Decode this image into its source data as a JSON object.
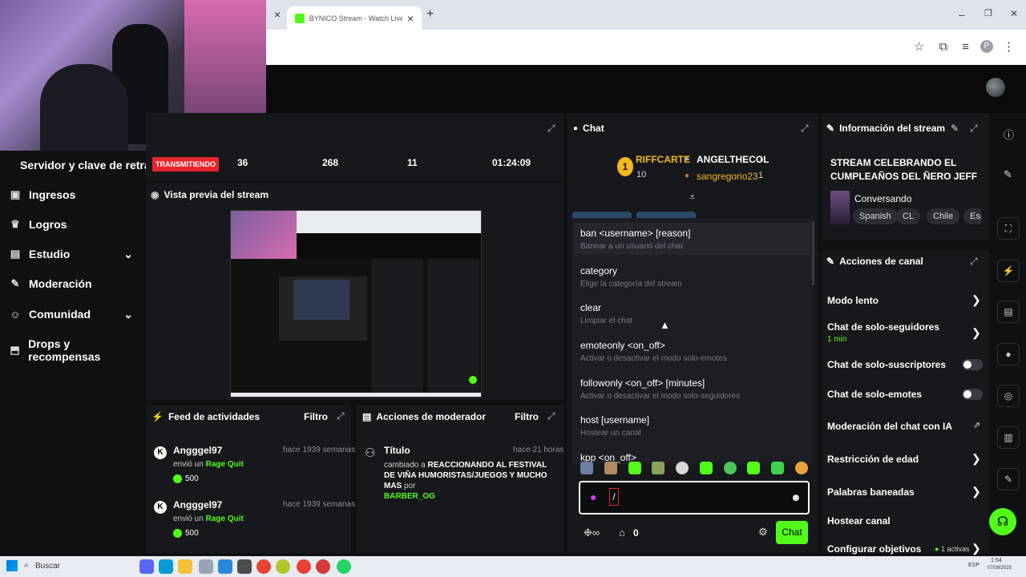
{
  "browser": {
    "tab_close": "×",
    "tab_title": "BYNICO Stream - Watch Live on Kick",
    "new_tab": "+",
    "profile_letter": "P",
    "win_min": "–",
    "win_max": "❐",
    "win_close": "✕"
  },
  "sidebar": {
    "stream_key_label": "Servidor y clave de retransm",
    "items": [
      {
        "label": "Ingresos",
        "icon": "dollar-icon"
      },
      {
        "label": "Logros",
        "icon": "trophy-icon"
      },
      {
        "label": "Estudio",
        "icon": "studio-icon"
      },
      {
        "label": "Moderación",
        "icon": "wrench-icon"
      },
      {
        "label": "Comunidad",
        "icon": "community-icon"
      },
      {
        "label": "Drops y recompensas",
        "icon": "drops-icon"
      }
    ]
  },
  "stats": {
    "live_badge": "TRANSMITIENDO",
    "viewers": "36",
    "followers": "268",
    "subs": "11",
    "uptime": "01:24:09"
  },
  "preview": {
    "title": "Vista previa del stream"
  },
  "activity": {
    "title": "Feed de actividades",
    "filter": "Filtro",
    "items": [
      {
        "user": "Angggel97",
        "time": "hace 1939 semanas",
        "action": "envió un",
        "item": "Rage Quit",
        "amount": "500"
      },
      {
        "user": "Angggel97",
        "time": "hace 1939 semanas",
        "action": "envió un",
        "item": "Rage Quit",
        "amount": "500"
      }
    ]
  },
  "mod_actions": {
    "title": "Acciones de moderador",
    "filter": "Filtro",
    "entry_label": "Título",
    "entry_time": "hace 21 horas",
    "entry_prefix": "cambiado a",
    "entry_value": "REACCIONANDO AL FESTIVAL DE VIÑA HUMORISTAS/JUEGOS Y MUCHO MAS",
    "entry_by": "por",
    "entry_user": "BARBER_OG"
  },
  "chat": {
    "title": "Chat",
    "leader1_rank": "1",
    "leader1_name": "RIFFCARTE",
    "leader1_count": "10",
    "leader2_name": "ANGELTHECOL",
    "leader2_count": "1",
    "leader3_name": "sangregorio23",
    "leader3_count": "1",
    "commands": [
      {
        "cmd": "ban <username> [reason]",
        "desc": "Banear a un usuario del chat"
      },
      {
        "cmd": "category",
        "desc": "Elige la categoría del stream"
      },
      {
        "cmd": "clear",
        "desc": "Limpiar el chat"
      },
      {
        "cmd": "emoteonly <on_off>",
        "desc": "Activar o desactivar el modo solo-emotes"
      },
      {
        "cmd": "followonly <on_off> [minutes]",
        "desc": "Activar o desactivar el modo solo-seguidores"
      },
      {
        "cmd": "host [username]",
        "desc": "Hostear un canal"
      },
      {
        "cmd": "kpp <on_off>",
        "desc": ""
      }
    ],
    "input_value": "/",
    "points": "0",
    "send_button": "Chat"
  },
  "stream_info": {
    "title": "Información del stream",
    "stream_title": "STREAM CELEBRANDO EL CUMPLEAÑOS DEL ÑERO JEFF 🔥🥳...",
    "category": "Conversando",
    "tags": [
      "Spanish",
      "CL",
      "Chile",
      "Espa"
    ]
  },
  "channel_actions": {
    "title": "Acciones de canal",
    "slow_mode": "Modo lento",
    "followers_only": "Chat de solo-seguidores",
    "followers_only_value": "1 min",
    "subs_only": "Chat de solo-suscriptores",
    "emotes_only": "Chat de solo-emotes",
    "ai_moderation": "Moderación del chat con IA",
    "age_restriction": "Restricción de edad",
    "banned_words": "Palabras baneadas",
    "host_channel": "Hostear canal",
    "goals": "Configurar objetivos",
    "goals_status": "1 activas"
  },
  "taskbar": {
    "search": "Buscar",
    "time": "1:54",
    "date": "07/09/2025",
    "lang": "ESP"
  },
  "colors": {
    "accent": "#53fc18",
    "live_red": "#e4262c",
    "panel": "#17181c"
  }
}
